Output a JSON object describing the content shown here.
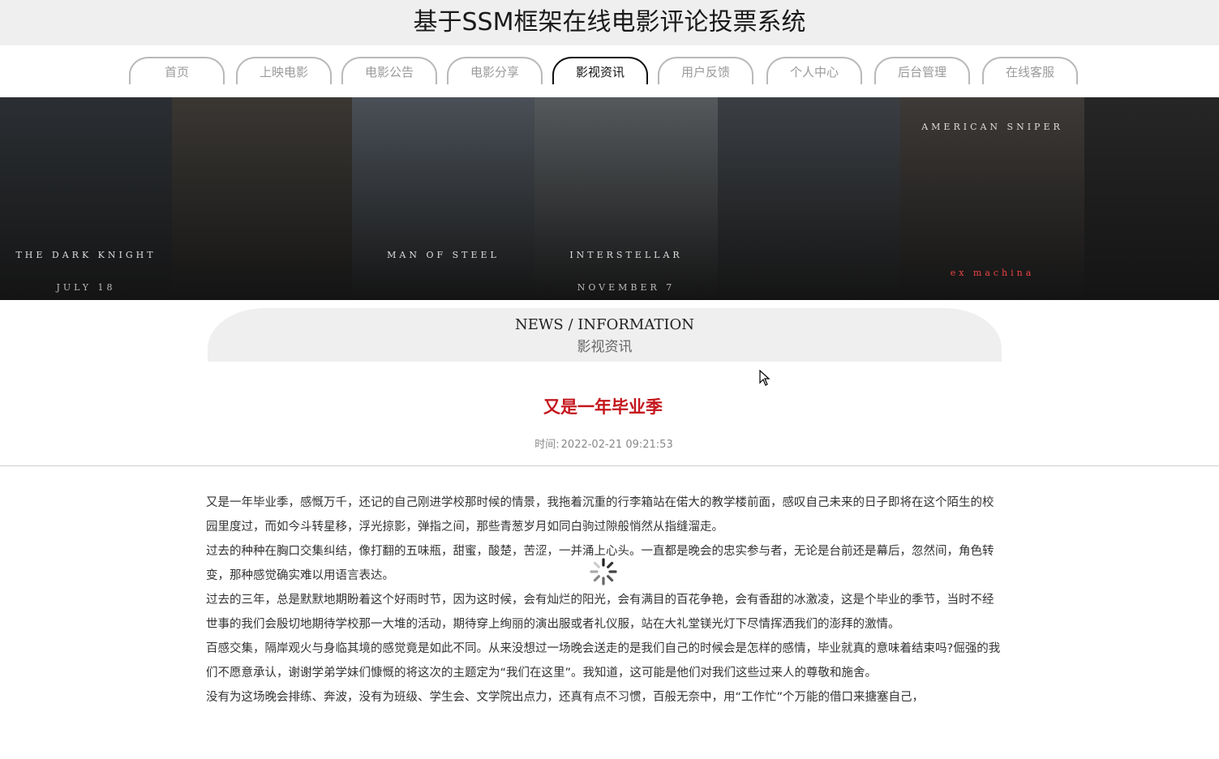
{
  "header": {
    "title": "基于SSM框架在线电影评论投票系统"
  },
  "nav": {
    "items": [
      {
        "label": "首页",
        "active": false
      },
      {
        "label": "上映电影",
        "active": false
      },
      {
        "label": "电影公告",
        "active": false
      },
      {
        "label": "电影分享",
        "active": false
      },
      {
        "label": "影视资讯",
        "active": true
      },
      {
        "label": "用户反馈",
        "active": false
      },
      {
        "label": "个人中心",
        "active": false
      },
      {
        "label": "后台管理",
        "active": false
      },
      {
        "label": "在线客服",
        "active": false
      }
    ]
  },
  "banner": {
    "posters": [
      {
        "text": "THE DARK KNIGHT",
        "sub": "JULY 18",
        "color": "#2b2f33"
      },
      {
        "text": "",
        "sub": "",
        "color": "#3a3733"
      },
      {
        "text": "MAN OF STEEL",
        "sub": "",
        "color": "#4a5057"
      },
      {
        "text": "INTERSTELLAR",
        "sub": "NOVEMBER 7",
        "color": "#55595c"
      },
      {
        "text": "",
        "sub": "",
        "color": "#3b3f44"
      },
      {
        "text": "AMERICAN SNIPER",
        "sub": "ex machina",
        "color": "#3e3a37"
      },
      {
        "text": "",
        "sub": "",
        "color": "#262626"
      }
    ]
  },
  "section": {
    "title_en": "NEWS / INFORMATION",
    "title_cn": "影视资讯"
  },
  "article": {
    "title": "又是一年毕业季",
    "time_label": "时间:",
    "time_value": "2022-02-21 09:21:53",
    "paragraphs": [
      "又是一年毕业季，感慨万千，还记的自己刚进学校那时候的情景，我拖着沉重的行李箱站在偌大的教学楼前面，感叹自己未来的日子即将在这个陌生的校园里度过，而如今斗转星移，浮光掠影，弹指之间，那些青葱岁月如同白驹过隙般悄然从指缝溜走。",
      "过去的种种在胸口交集纠结，像打翻的五味瓶，甜蜜，酸楚，苦涩，一并涌上心头。一直都是晚会的忠实参与者，无论是台前还是幕后，忽然间，角色转变，那种感觉确实难以用语言表达。",
      "过去的三年，总是默默地期盼着这个好雨时节，因为这时候，会有灿烂的阳光，会有满目的百花争艳，会有香甜的冰激凌，这是个毕业的季节，当时不经世事的我们会殷切地期待学校那一大堆的活动，期待穿上绚丽的演出服或者礼仪服，站在大礼堂镁光灯下尽情挥洒我们的澎拜的激情。",
      "百感交集，隔岸观火与身临其境的感觉竟是如此不同。从来没想过一场晚会送走的是我们自己的时候会是怎样的感情，毕业就真的意味着结束吗?倔强的我们不愿意承认，谢谢学弟学妹们慷慨的将这次的主题定为“我们在这里”。我知道，这可能是他们对我们这些过来人的尊敬和施舍。",
      "没有为这场晚会排练、奔波，没有为班级、学生会、文学院出点力，还真有点不习惯，百般无奈中，用“工作忙”个万能的借口来搪塞自己，"
    ]
  }
}
